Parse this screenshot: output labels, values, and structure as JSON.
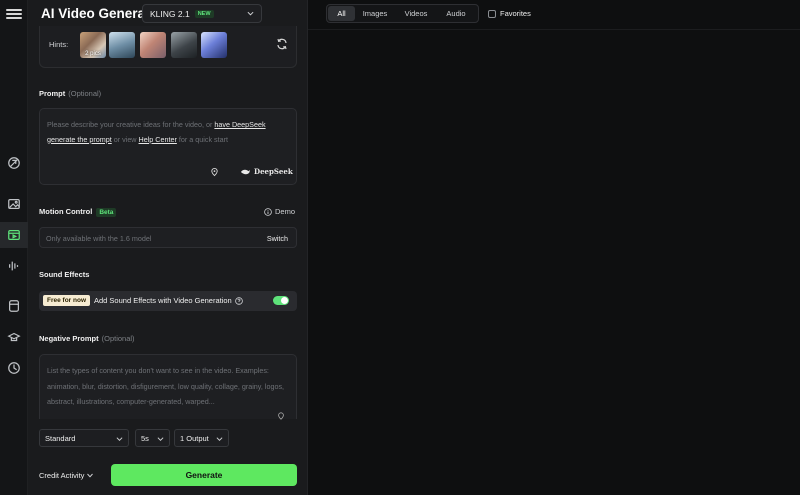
{
  "app": {
    "title": "AI Video Generator"
  },
  "model": {
    "name": "KLING 2.1",
    "badge": "NEW"
  },
  "hints": {
    "label": "Hints:",
    "first_overlay": "2 pics"
  },
  "prompt": {
    "label": "Prompt",
    "optional": "(Optional)",
    "placeholder_start": "Please describe your creative ideas for the video, or",
    "link_deepseek": "have DeepSeek generate the prompt",
    "placeholder_mid": "or view",
    "link_help": "Help Center",
    "placeholder_end": "for a quick start",
    "deepseek_label": "DeepSeek"
  },
  "motion_control": {
    "label": "Motion Control",
    "badge": "Beta",
    "demo_label": "Demo",
    "note": "Only available with the 1.6 model",
    "switch_label": "Switch"
  },
  "sound_effects": {
    "label": "Sound Effects",
    "free_badge": "Free for now",
    "text": "Add Sound Effects with Video Generation",
    "enabled": true
  },
  "negative_prompt": {
    "label": "Negative Prompt",
    "optional": "(Optional)",
    "placeholder": "List the types of content you don't want to see in the video. Examples: animation, blur, distortion, disfigurement, low quality, collage, grainy, logos, abstract, illustrations, computer-generated, warped..."
  },
  "options": {
    "mode": "Standard",
    "duration": "5s",
    "outputs": "1 Output"
  },
  "footer": {
    "credit_label": "Credit Activity",
    "generate_label": "Generate"
  },
  "gallery": {
    "tabs": [
      "All",
      "Images",
      "Videos",
      "Audio"
    ],
    "active_tab": "All",
    "favorites_label": "Favorites"
  },
  "colors": {
    "accent": "#5ee860",
    "panel": "#1a1b1d",
    "background": "#0e0f10"
  }
}
